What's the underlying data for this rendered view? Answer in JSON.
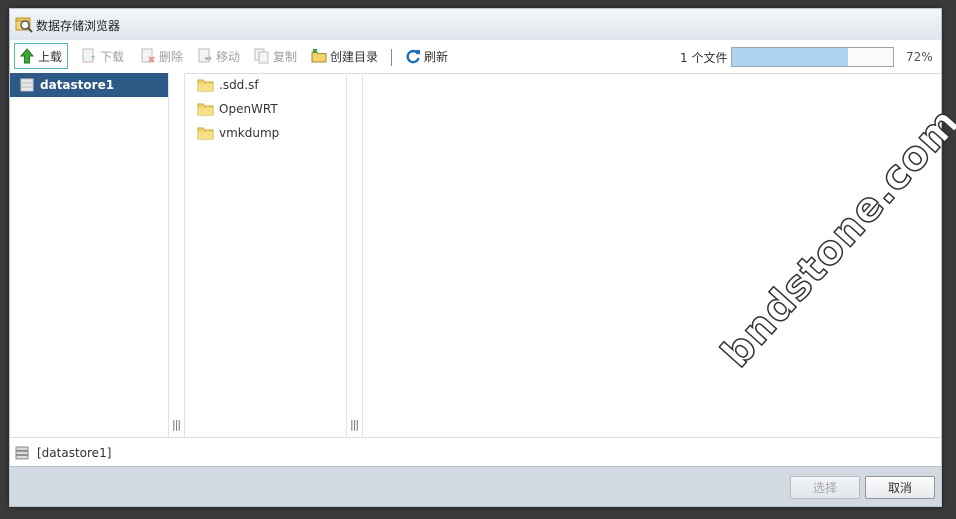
{
  "window": {
    "title": "数据存储浏览器"
  },
  "toolbar": {
    "upload": "上载",
    "download": "下载",
    "delete": "删除",
    "move": "移动",
    "copy": "复制",
    "mkdir": "创建目录",
    "refresh": "刷新"
  },
  "progress": {
    "count_label": "1 个文件",
    "percent_label": "72%",
    "value": 0.72
  },
  "datastores": [
    {
      "label": "datastore1",
      "selected": true
    }
  ],
  "folders": [
    {
      "label": ".sdd.sf"
    },
    {
      "label": "OpenWRT"
    },
    {
      "label": "vmkdump"
    }
  ],
  "status": {
    "path": "[datastore1]"
  },
  "footer": {
    "select": "选择",
    "cancel": "取消"
  },
  "watermark": "bndstone.com",
  "colors": {
    "selected_bg": "#2d5987",
    "progress_fill": "#aed3ee",
    "footer_bg": "#d2d9e0"
  }
}
